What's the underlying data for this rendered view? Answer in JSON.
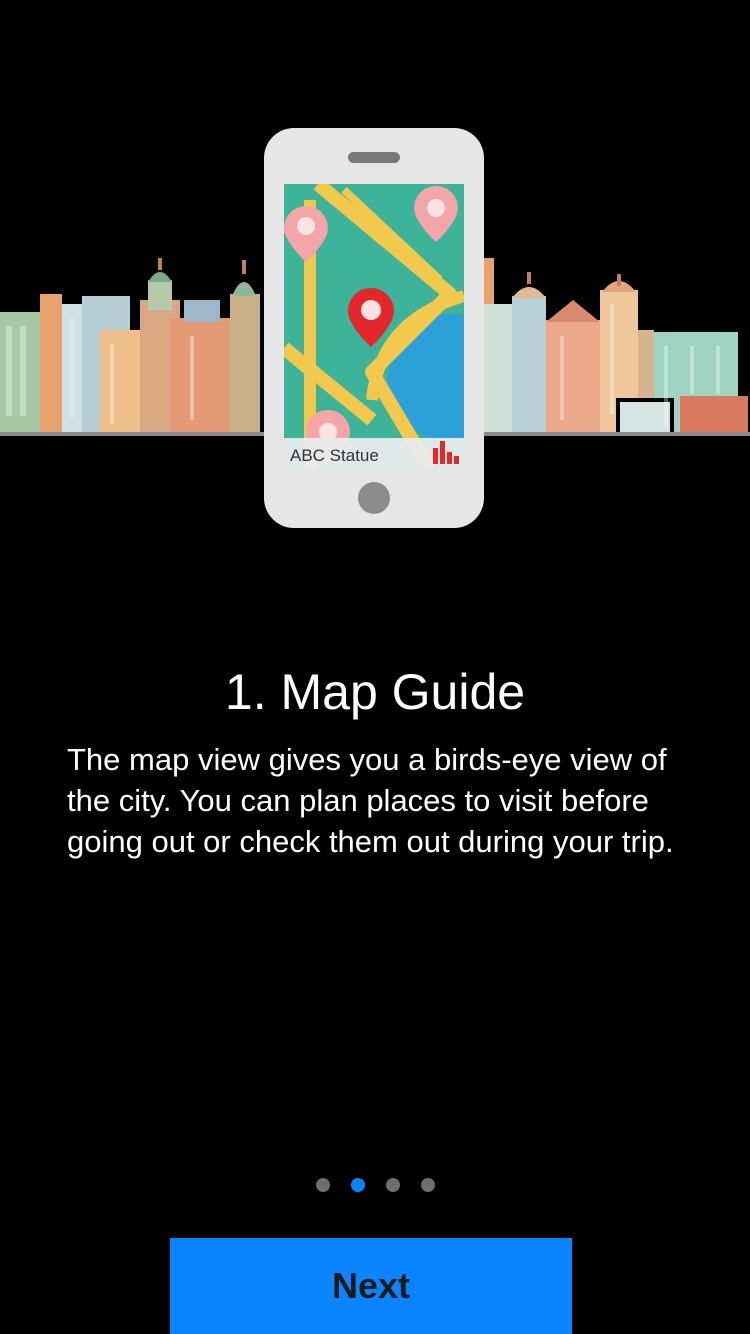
{
  "hero": {
    "phone_label": "ABC Statue",
    "icons": [
      "city-skyline",
      "map-pin-icon",
      "bar-chart-icon"
    ]
  },
  "onboarding": {
    "title": "1. Map Guide",
    "description": "The map view gives you a birds-eye view of the city. You can plan places to visit before going out or check them out during your trip."
  },
  "pager": {
    "total": 4,
    "active_index": 1
  },
  "actions": {
    "next_label": "Next"
  },
  "colors": {
    "background": "#000000",
    "accent": "#0a84ff",
    "dot_inactive": "#6d6d72",
    "button_text": "#1a1a1a",
    "map_green": "#3db39a",
    "road_yellow": "#f2c94c",
    "pin_red": "#e5262b",
    "pin_pink": "#f4a5a8"
  }
}
